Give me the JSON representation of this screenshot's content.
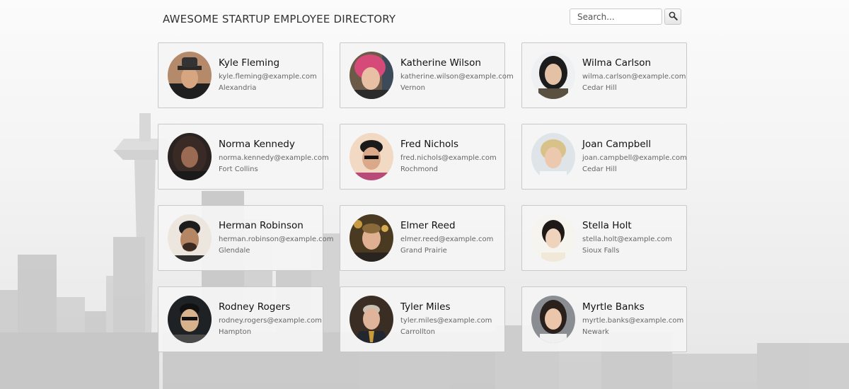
{
  "header": {
    "title": "AWESOME STARTUP EMPLOYEE DIRECTORY"
  },
  "search": {
    "placeholder": "Search...",
    "button_icon": "magnifier-icon"
  },
  "colors": {
    "background": "#f2f2f2",
    "card_background": "#f4f4f4",
    "card_border": "#c9c9c9",
    "name_text": "#111111",
    "detail_text": "#666666"
  },
  "employees": [
    {
      "name": "Kyle Fleming",
      "email": "kyle.fleming@example.com",
      "city": "Alexandria"
    },
    {
      "name": "Katherine Wilson",
      "email": "katherine.wilson@example.com",
      "city": "Vernon"
    },
    {
      "name": "Wilma Carlson",
      "email": "wilma.carlson@example.com",
      "city": "Cedar Hill"
    },
    {
      "name": "Norma Kennedy",
      "email": "norma.kennedy@example.com",
      "city": "Fort Collins"
    },
    {
      "name": "Fred Nichols",
      "email": "fred.nichols@example.com",
      "city": "Rochmond"
    },
    {
      "name": "Joan Campbell",
      "email": "joan.campbell@example.com",
      "city": "Cedar Hill"
    },
    {
      "name": "Herman Robinson",
      "email": "herman.robinson@example.com",
      "city": "Glendale"
    },
    {
      "name": "Elmer Reed",
      "email": "elmer.reed@example.com",
      "city": "Grand Prairie"
    },
    {
      "name": "Stella Holt",
      "email": "stella.holt@example.com",
      "city": "Sioux Falls"
    },
    {
      "name": "Rodney Rogers",
      "email": "rodney.rogers@example.com",
      "city": "Hampton"
    },
    {
      "name": "Tyler Miles",
      "email": "tyler.miles@example.com",
      "city": "Carrollton"
    },
    {
      "name": "Myrtle Banks",
      "email": "myrtle.banks@example.com",
      "city": "Newark"
    }
  ]
}
